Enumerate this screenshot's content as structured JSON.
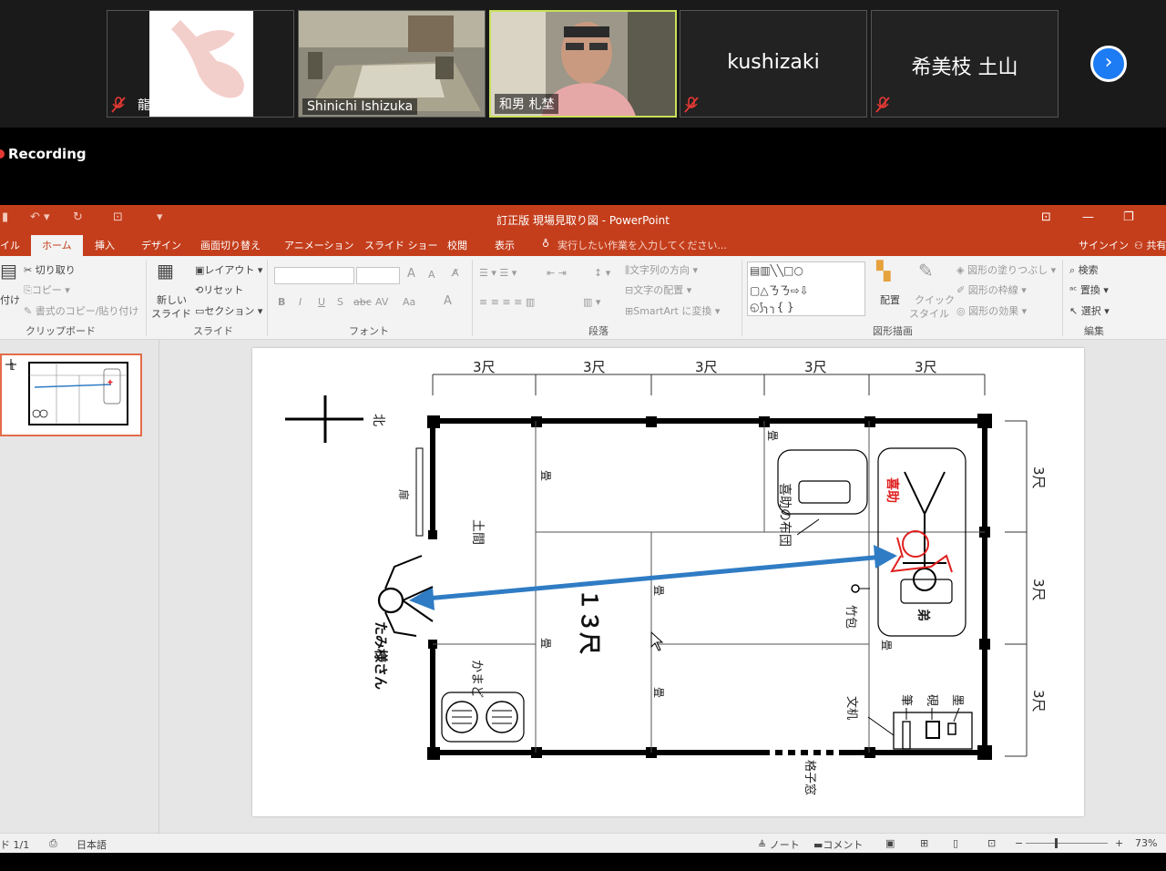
{
  "meeting": {
    "participants": [
      {
        "name": "龍谷・犯罪学研究…",
        "muted": true
      },
      {
        "name": "Shinichi Ishizuka",
        "muted": false
      },
      {
        "name": "和男 札埜",
        "muted": false
      },
      {
        "name": "kushizaki",
        "muted": true
      },
      {
        "name": "希美枝 土山",
        "muted": true
      }
    ],
    "next_icon": "chevron-right-icon",
    "recording_label": "Recording"
  },
  "app": {
    "title": "訂正版 現場見取り図 - PowerPoint",
    "tabs": [
      "イル",
      "ホーム",
      "挿入",
      "デザイン",
      "画面切り替え",
      "アニメーション",
      "スライド ショー",
      "校閲",
      "表示"
    ],
    "tell_me": "実行したい作業を入力してください...",
    "signin": "サインイン",
    "share": "共有"
  },
  "ribbon": {
    "clipboard": {
      "paste": "付け",
      "cut": "切り取り",
      "copy": "コピー",
      "format_painter": "書式のコピー/貼り付け",
      "label": "クリップボード"
    },
    "slides": {
      "new_slide_1": "新しい",
      "new_slide_2": "スライド",
      "layout": "レイアウト",
      "reset": "リセット",
      "section": "セクション",
      "label": "スライド"
    },
    "font": {
      "bold": "B",
      "italic": "I",
      "underline": "U",
      "shadow": "S",
      "strike": "abc",
      "spacing": "AV",
      "case": "Aa",
      "color": "A",
      "grow": "A",
      "shrink": "A",
      "label": "フォント"
    },
    "paragraph": {
      "text_direction": "文字列の方向",
      "align_text": "文字の配置",
      "smartart": "SmartArt に変換",
      "label": "段落"
    },
    "drawing": {
      "arrange": "配置",
      "quick_styles_1": "クイック",
      "quick_styles_2": "スタイル",
      "shape_fill": "図形の塗りつぶし",
      "shape_outline": "図形の枠線",
      "shape_effects": "図形の効果",
      "label": "図形描画"
    },
    "editing": {
      "find": "検索",
      "replace": "置換",
      "select": "選択",
      "label": "編集"
    }
  },
  "slide": {
    "thumb_number": "1",
    "dims_top": [
      "3尺",
      "3尺",
      "3尺",
      "3尺",
      "3尺"
    ],
    "dims_right": [
      "3尺",
      "3尺",
      "3尺"
    ],
    "north": "北",
    "door": "扉",
    "doma": "土間",
    "tatami": "畳",
    "kamado": "かまど",
    "futon": "喜助の布団",
    "kisuke": "喜助",
    "brother": "弟",
    "bamboo": "竹包",
    "desk": "文机",
    "brush": "筆",
    "inkstone": "硯",
    "ink": "墨",
    "lattice": "格子窓",
    "distance": "１３尺",
    "person": "たみ様さん",
    "arrow_color": "#2f7cc4",
    "kisuke_color": "#e02020"
  },
  "status": {
    "slide": "ド 1/1",
    "language": "日本語",
    "notes": "ノート",
    "comments": "コメント",
    "zoom": "73%"
  }
}
